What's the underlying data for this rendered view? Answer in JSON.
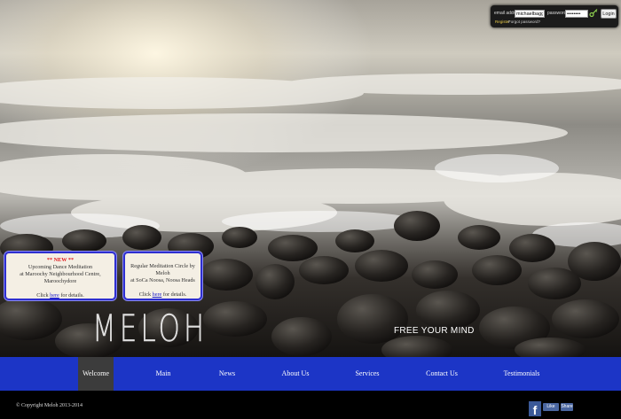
{
  "login": {
    "email_label": "email address",
    "email_value": "michaelbaggett",
    "password_label": "password",
    "password_value": "••••••••",
    "login_button": "Login",
    "register_link": "Register",
    "forgot_link": "Forgot password?"
  },
  "notices": [
    {
      "badge": "** NEW **",
      "line1": "Upcoming Dance Meditation",
      "line2": "at Maroochy Neighbourhood Centre, Maroochydore",
      "click_prefix": "Click",
      "link": "here",
      "click_suffix": "for details."
    },
    {
      "line1": "Regular Meditation Circle by Meloh",
      "line2": "at SoCa Noosa, Noosa Heads",
      "click_prefix": "Click",
      "link": "here",
      "click_suffix": "for details."
    }
  ],
  "brand": {
    "logo": "MELOH",
    "tagline": "FREE YOUR MIND"
  },
  "nav": {
    "items": [
      {
        "label": "Welcome"
      },
      {
        "label": "Main"
      },
      {
        "label": "News"
      },
      {
        "label": "About Us"
      },
      {
        "label": "Services"
      },
      {
        "label": "Contact Us"
      },
      {
        "label": "Testimonials"
      }
    ],
    "active": "Welcome"
  },
  "footer": {
    "copyright": "© Copyright Meloh 2013-2014",
    "like": "Like",
    "share": "Share"
  },
  "colors": {
    "nav": "#1c35c6",
    "nav_active": "#3c3c3c",
    "notice_border": "#2e2fd0",
    "new_badge": "#e0161a"
  },
  "icons": {
    "facebook": "facebook-icon",
    "key": "key-icon"
  }
}
